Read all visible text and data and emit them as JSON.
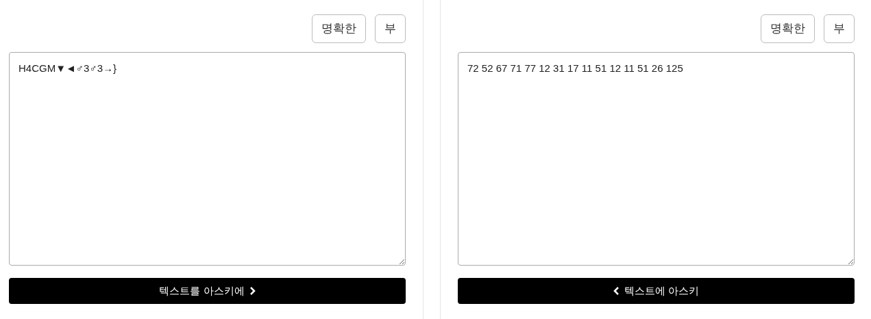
{
  "panels": [
    {
      "buttons": [
        "명확한",
        "부"
      ],
      "textarea": {
        "value": "H4CGM▼◄♂3♂3→}"
      },
      "convert_button": {
        "label": "텍스트를 아스키에",
        "kind": "forward"
      }
    },
    {
      "buttons": [
        "명확한",
        "부"
      ],
      "textarea": {
        "value": "72 52 67 71 77 12 31 17 11 51 12 11 51 26 125"
      },
      "convert_button": {
        "label": "텍스트에 아스키",
        "kind": "backward"
      }
    }
  ]
}
